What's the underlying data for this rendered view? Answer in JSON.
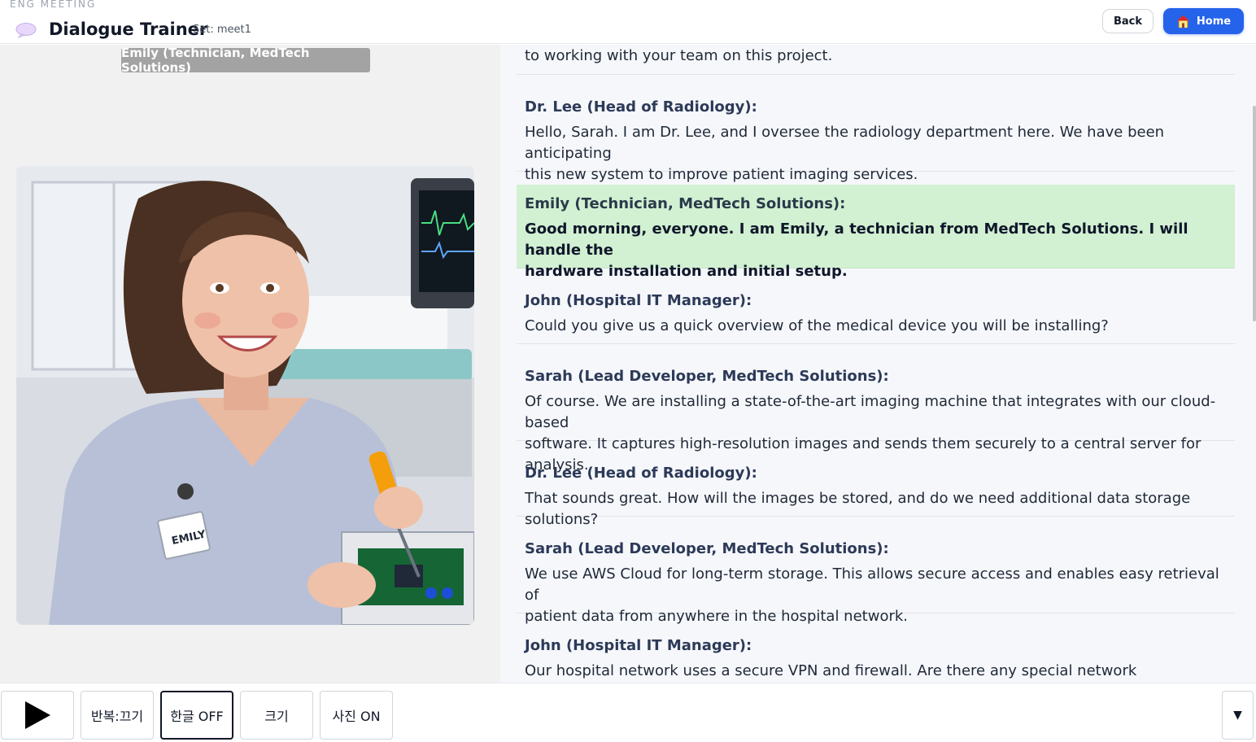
{
  "header": {
    "brand": "ENG MEETING",
    "title": "Dialogue Trainer",
    "set_label": "Set: meet1",
    "back_label": "Back",
    "home_label": "Home"
  },
  "left": {
    "speaker_badge": "Emily (Technician, MedTech Solutions)",
    "name_tag": "EMILY"
  },
  "transcript": {
    "partial_top": "to working with your team on this project.",
    "turns": [
      {
        "speaker": "Dr. Lee (Head of Radiology):",
        "line1": "Hello, Sarah. I am Dr. Lee, and I oversee the radiology department here. We have been anticipating",
        "line2": "this new system to improve patient imaging services."
      },
      {
        "speaker": "Emily (Technician, MedTech Solutions):",
        "line1": "Good morning, everyone. I am Emily, a technician from MedTech Solutions. I will handle the",
        "line2": "hardware installation and initial setup."
      },
      {
        "speaker": "John (Hospital IT Manager):",
        "line1": "Could you give us a quick overview of the medical device you will be installing?"
      },
      {
        "speaker": "Sarah (Lead Developer, MedTech Solutions):",
        "line1": "Of course. We are installing a state-of-the-art imaging machine that integrates with our cloud-based",
        "line2": "software. It captures high-resolution images and sends them securely to a central server for analysis."
      },
      {
        "speaker": "Dr. Lee (Head of Radiology):",
        "line1": "That sounds great. How will the images be stored, and do we need additional data storage solutions?"
      },
      {
        "speaker": "Sarah (Lead Developer, MedTech Solutions):",
        "line1": "We use AWS Cloud for long-term storage. This allows secure access and enables easy retrieval of",
        "line2": "patient data from anywhere in the hospital network."
      },
      {
        "speaker": "John (Hospital IT Manager):",
        "line1": "Our hospital network uses a secure VPN and firewall. Are there any special network requirements we"
      }
    ]
  },
  "toolbar": {
    "repeat_label": "반복:끄기",
    "korean_label": "한글 OFF",
    "size_label": "크기",
    "photo_label": "사진 ON",
    "dropdown_glyph": "▼"
  },
  "colors": {
    "accent": "#2563eb",
    "active_row": "#d2f0d2",
    "speaker_text": "#2c3a58"
  }
}
